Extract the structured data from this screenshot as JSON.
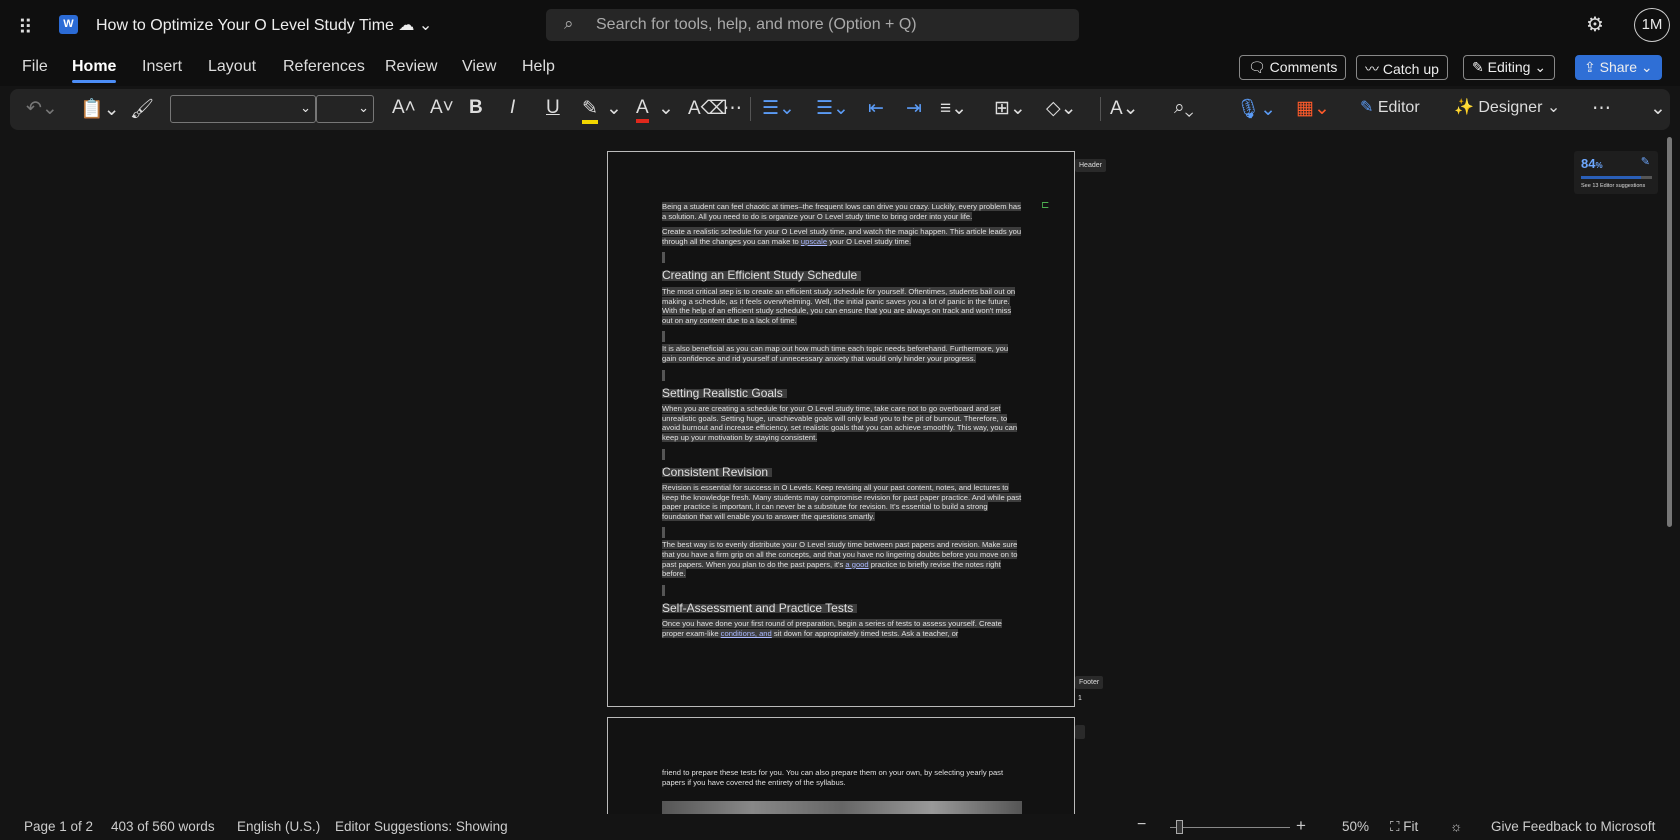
{
  "titlebar": {
    "title": "How to Optimize Your O Level Study Time",
    "search_placeholder": "Search for tools, help, and more (Option + Q)",
    "avatar": "1M",
    "app_icon": "W"
  },
  "menu": [
    "File",
    "Home",
    "Insert",
    "Layout",
    "References",
    "Review",
    "View",
    "Help"
  ],
  "actions": {
    "comments": "Comments",
    "catchup": "Catch up",
    "editing": "Editing",
    "share": "Share"
  },
  "toolbar": {
    "editor": "Editor",
    "designer": "Designer"
  },
  "editor_card": {
    "score": "84",
    "pct": "%",
    "suggestions": "See 13 Editor suggestions",
    "fraction": 0.84
  },
  "page_labels": {
    "header": "Header",
    "footer": "Footer",
    "page_number": "1"
  },
  "doc": {
    "p1": "Being a student can feel chaotic at times–the frequent lows can drive you crazy. Luckily, every problem has a solution. All you need to do is organize your O Level study time to bring order into your life.",
    "p2a": "Create a realistic schedule for your O Level study time, and watch the magic happen. This article leads you through all the changes you can make to ",
    "p2link": "upscale",
    "p2b": " your O Level study time.",
    "h1": "Creating an Efficient Study Schedule",
    "p3": "The most critical step is to create an efficient study schedule for yourself. Oftentimes, students bail out on making a schedule, as it feels overwhelming. Well, the initial panic saves you a lot of panic in the future. With the help of an efficient study schedule, you can ensure that you are always on track and won't miss out on any content due to a lack of time.",
    "p4": "It is also beneficial as you can map out how much time each topic needs beforehand. Furthermore, you gain confidence and rid yourself of unnecessary anxiety that would only hinder your progress.",
    "h2": "Setting Realistic Goals",
    "p5": "When you are creating a schedule for your O Level study time, take care not to go overboard and set unrealistic goals. Setting huge, unachievable goals will only lead you to the pit of burnout. Therefore, to avoid burnout and increase efficiency, set realistic goals that you can achieve smoothly. This way, you can keep up your motivation by staying consistent.",
    "h3": "Consistent Revision",
    "p6": "Revision is essential for success in O Levels. Keep revising all your past content, notes, and lectures to keep the knowledge fresh. Many students may compromise revision for past paper practice. And while past paper practice is important, it can never be a substitute for revision. It's essential to build a strong foundation that will enable you to answer the questions smartly.",
    "p7a": "The best way is to evenly distribute your O Level study time between past papers and revision. Make sure that you have a firm grip on all the concepts, and that you have no lingering doubts before you move on to past papers. When you plan to do the past papers, it's ",
    "p7link": "a good",
    "p7b": " practice to briefly revise the notes right before.",
    "h4": "Self-Assessment and Practice Tests",
    "p8a": "Once you have done your first round of preparation, begin a series of tests to assess yourself. Create proper exam-like ",
    "p8link": "conditions, and",
    "p8b": " sit down for appropriately timed tests. Ask a teacher, or",
    "p9": "friend to prepare these tests for you. You can also prepare them on your own, by selecting yearly past papers if you have covered the entirety of the syllabus."
  },
  "status": {
    "page": "Page 1 of 2",
    "words": "403 of 560 words",
    "lang": "English (U.S.)",
    "editor": "Editor Suggestions: Showing",
    "zoom": "50%",
    "fit": "Fit",
    "feedback": "Give Feedback to Microsoft"
  }
}
